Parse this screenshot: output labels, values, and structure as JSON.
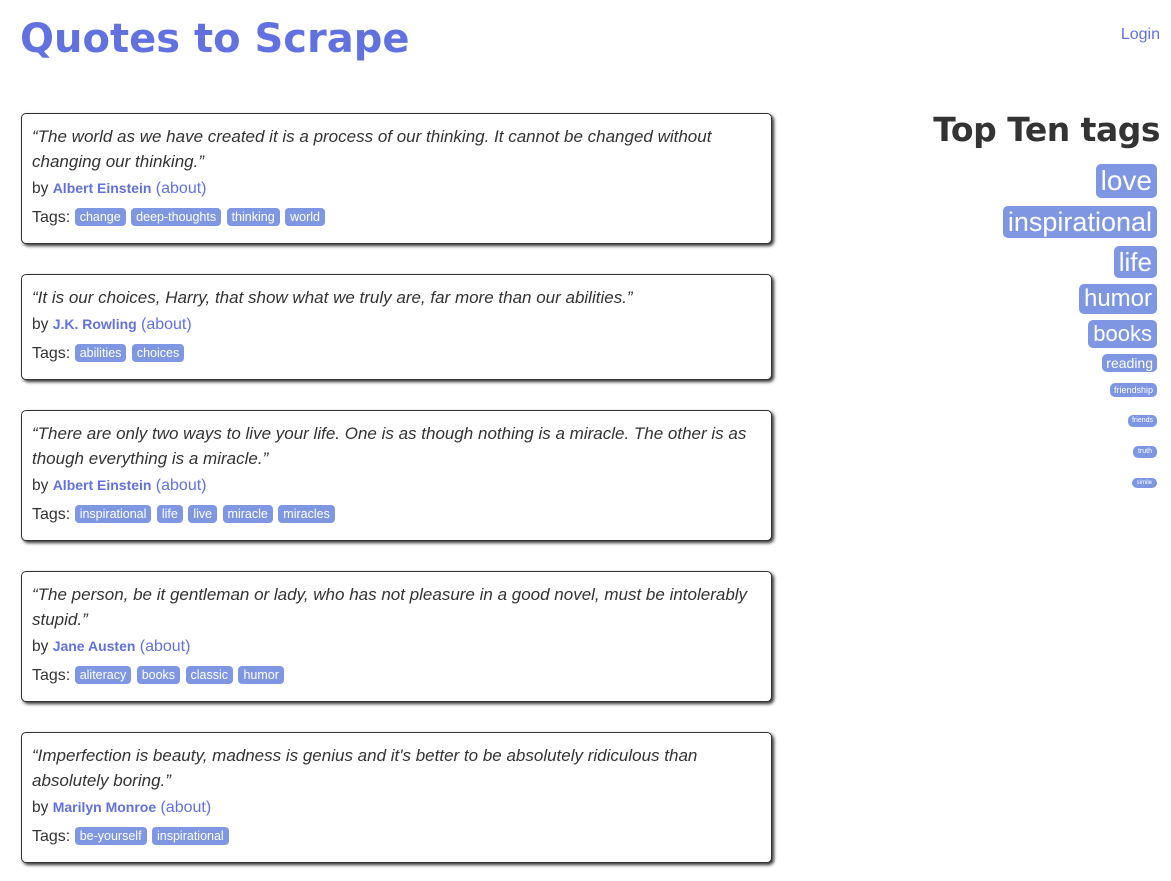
{
  "header": {
    "title": "Quotes to Scrape",
    "login_label": "Login"
  },
  "quotes": [
    {
      "text": "“The world as we have created it is a process of our thinking. It cannot be changed without changing our thinking.”",
      "by": "by",
      "author": "Albert Einstein",
      "about": "(about)",
      "tags_label": "Tags:",
      "tags": [
        "change",
        "deep-thoughts",
        "thinking",
        "world"
      ]
    },
    {
      "text": "“It is our choices, Harry, that show what we truly are, far more than our abilities.”",
      "by": "by",
      "author": "J.K. Rowling",
      "about": "(about)",
      "tags_label": "Tags:",
      "tags": [
        "abilities",
        "choices"
      ]
    },
    {
      "text": "“There are only two ways to live your life. One is as though nothing is a miracle. The other is as though everything is a miracle.”",
      "by": "by",
      "author": "Albert Einstein",
      "about": "(about)",
      "tags_label": "Tags:",
      "tags": [
        "inspirational",
        "life",
        "live",
        "miracle",
        "miracles"
      ]
    },
    {
      "text": "“The person, be it gentleman or lady, who has not pleasure in a good novel, must be intolerably stupid.”",
      "by": "by",
      "author": "Jane Austen",
      "about": "(about)",
      "tags_label": "Tags:",
      "tags": [
        "aliteracy",
        "books",
        "classic",
        "humor"
      ]
    },
    {
      "text": "“Imperfection is beauty, madness is genius and it's better to be absolutely ridiculous than absolutely boring.”",
      "by": "by",
      "author": "Marilyn Monroe",
      "about": "(about)",
      "tags_label": "Tags:",
      "tags": [
        "be-yourself",
        "inspirational"
      ]
    }
  ],
  "sidebar": {
    "title": "Top Ten tags",
    "tags": [
      "love",
      "inspirational",
      "life",
      "humor",
      "books",
      "reading",
      "friendship",
      "friends",
      "truth",
      "simile"
    ]
  },
  "colors": {
    "accent": "#6271e0",
    "tag_background": "#7f96e3",
    "text": "#333333"
  }
}
